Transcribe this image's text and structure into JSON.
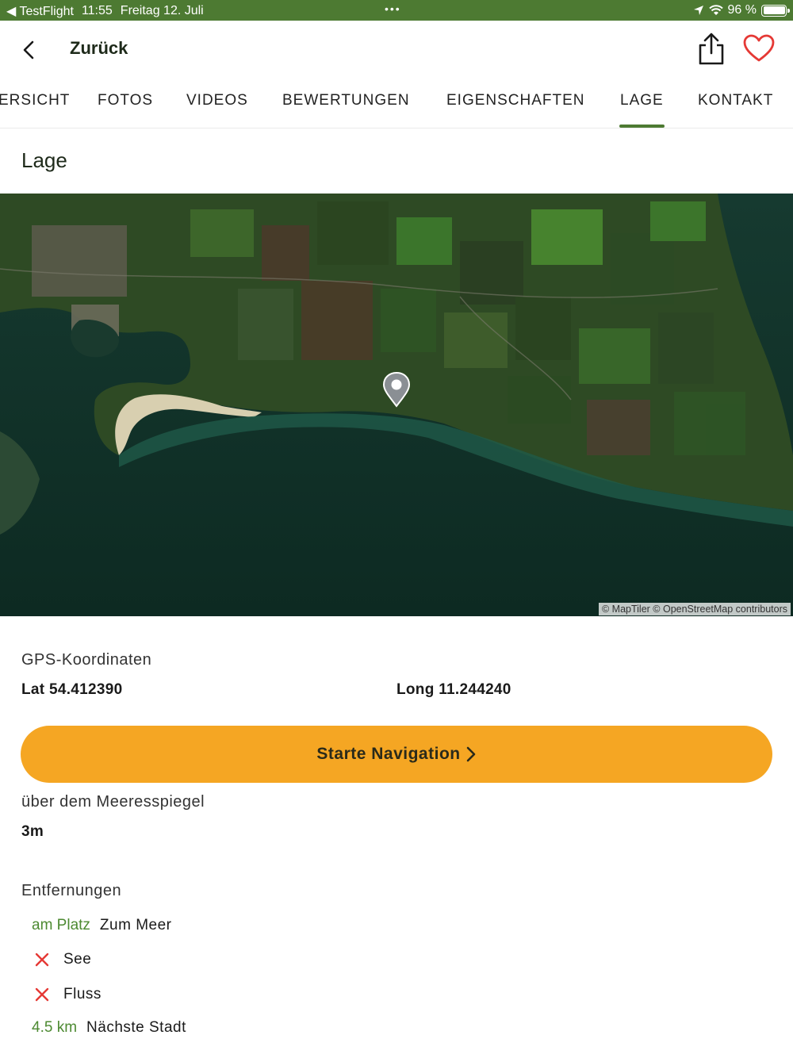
{
  "status_bar": {
    "back_app": "◀ TestFlight",
    "time": "11:55",
    "date": "Freitag 12. Juli",
    "dots": "•••",
    "battery": "96 %"
  },
  "header": {
    "back_label": "Zurück"
  },
  "tabs": [
    {
      "label": "ÜBERSICHT",
      "visible": "ERSICHT"
    },
    {
      "label": "FOTOS"
    },
    {
      "label": "VIDEOS"
    },
    {
      "label": "BEWERTUNGEN"
    },
    {
      "label": "EIGENSCHAFTEN"
    },
    {
      "label": "LAGE",
      "active": true
    },
    {
      "label": "KONTAKT"
    }
  ],
  "section": {
    "title": "Lage"
  },
  "map": {
    "attribution": "© MapTiler © OpenStreetMap contributors",
    "style": "satellite"
  },
  "gps": {
    "label": "GPS-Koordinaten",
    "lat": "Lat 54.412390",
    "long": "Long 11.244240"
  },
  "navigation_button": {
    "label": "Starte Navigation"
  },
  "elevation": {
    "label": "über dem Meeresspiegel",
    "value": "3m"
  },
  "distances": {
    "label": "Entfernungen",
    "items": [
      {
        "value": "am Platz",
        "label": "Zum Meer"
      },
      {
        "value": "",
        "label": "See",
        "icon": "x-icon"
      },
      {
        "value": "",
        "label": "Fluss",
        "icon": "x-icon"
      },
      {
        "value": "4.5 km",
        "label": "Nächste Stadt"
      }
    ]
  },
  "colors": {
    "brand_green": "#4d7a32",
    "accent_orange": "#f5a623",
    "cross_red": "#e53935"
  }
}
